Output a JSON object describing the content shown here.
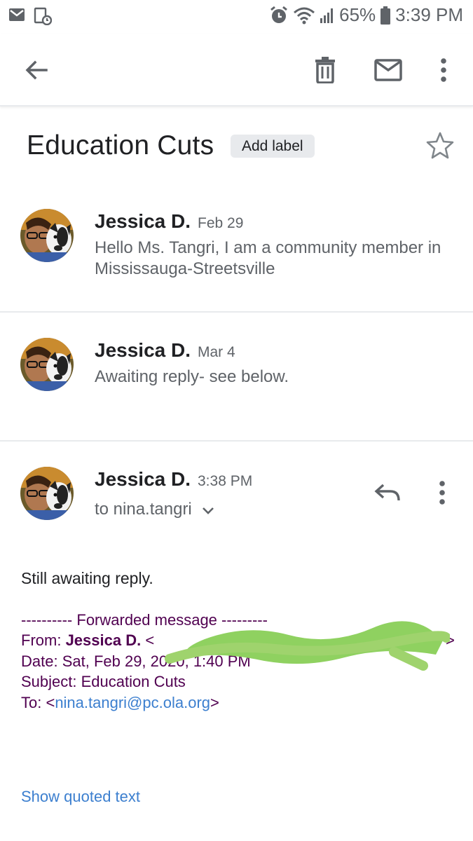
{
  "status_bar": {
    "battery": "65%",
    "time": "3:39 PM",
    "icons": [
      "gmail-icon",
      "calendar-notification-icon",
      "alarm-icon",
      "wifi-icon",
      "signal-icon",
      "battery-icon"
    ]
  },
  "toolbar": {
    "icons": [
      "back-arrow-icon",
      "delete-icon",
      "mark-unread-icon",
      "more-vert-icon"
    ]
  },
  "thread": {
    "subject": "Education Cuts",
    "add_label": "Add label"
  },
  "messages": [
    {
      "sender": "Jessica D.",
      "date": "Feb 29",
      "snippet": "Hello Ms. Tangri, I am a community member in Mississauga-Streetsville"
    },
    {
      "sender": "Jessica D.",
      "date": "Mar 4",
      "snippet": "Awaiting reply- see below."
    },
    {
      "sender": "Jessica D.",
      "date": "3:38 PM",
      "to": "to nina.tangri",
      "body": "Still awaiting reply.",
      "forwarded": {
        "header": "---------- Forwarded message ---------",
        "from_label": "From: ",
        "from_name": "Jessica D.",
        "from_open": " <",
        "from_close": ">",
        "date": "Date: Sat, Feb 29, 2020, 1:40 PM",
        "subject": "Subject: Education Cuts",
        "to_label": "To: <",
        "to_email": "nina.tangri@pc.ola.org",
        "to_close": ">"
      },
      "show_quoted": "Show quoted text"
    }
  ],
  "colors": {
    "accent_link": "#3c7fcf",
    "forwarded_text": "#500050",
    "redaction": "#8fd160"
  }
}
